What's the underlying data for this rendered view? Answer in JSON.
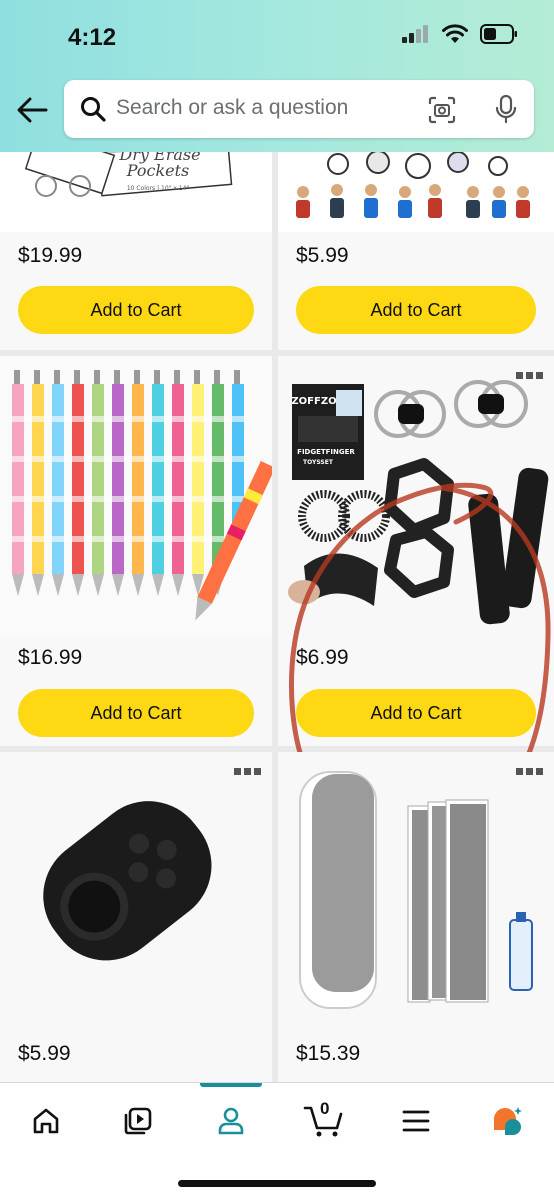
{
  "status_bar": {
    "time": "4:12"
  },
  "search": {
    "placeholder": "Search or ask a question"
  },
  "products": [
    {
      "name": "dry-erase-pockets",
      "price": "$19.99",
      "cart_label": "Add to Cart",
      "image_text_1": "Dry Erase",
      "image_text_2": "Pockets",
      "image_text_3": "10 Colors | 10\" x 14\""
    },
    {
      "name": "soccer-stickers",
      "price": "$5.99",
      "cart_label": "Add to Cart"
    },
    {
      "name": "birthday-pens",
      "price": "$16.99",
      "cart_label": "Add to Cart"
    },
    {
      "name": "fidget-finger-toys",
      "price": "$6.99",
      "cart_label": "Add to Cart",
      "image_text_1": "ZOFFZO",
      "image_text_2": "FIDGETFINGER",
      "image_text_3": "TOYSSET"
    },
    {
      "name": "fidget-pad",
      "price": "$5.99"
    },
    {
      "name": "whiteboard-erasers",
      "price": "$15.39"
    }
  ],
  "tab_bar": {
    "cart_count": "0"
  },
  "colors": {
    "cart_button": "#ffd814",
    "accent": "#1a8f9a",
    "annotation": "#b5381f"
  }
}
